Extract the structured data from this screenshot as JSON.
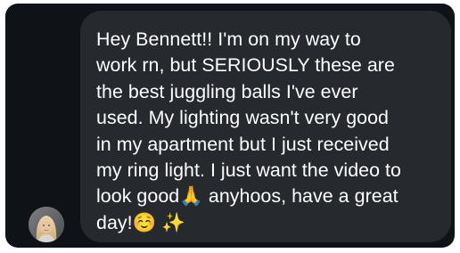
{
  "message": {
    "text": "Hey Bennett!! I'm on my way to\nwork rn, but SERIOUSLY these are\nthe best juggling balls I've ever\nused. My lighting wasn't very good\nin my apartment but I just received\nmy ring light. I just want the video to\nlook good🙏 anyhoos, have a great\nday!☺️ ✨"
  },
  "sender": {
    "avatar_icon": "profile-photo"
  },
  "colors": {
    "background": "#0f1217",
    "bubble": "#262a2f",
    "text": "#ffffff"
  }
}
